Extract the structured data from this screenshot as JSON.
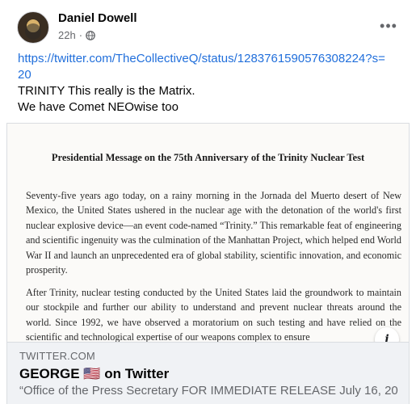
{
  "post": {
    "author": "Daniel Dowell",
    "time": "22h",
    "visibility_icon": "globe-icon",
    "more_icon": "more-options-icon",
    "more_label": "•••",
    "link_url": "https://twitter.com/TheCollectiveQ/status/1283761590576308224?s=20",
    "text_line1": "TRINITY This really is the Matrix.",
    "text_line2": "We have Comet NEOwise too"
  },
  "preview": {
    "doc_title": "Presidential Message on the 75th Anniversary of the Trinity Nuclear Test",
    "doc_para1": "Seventy-five years ago today, on a rainy morning in the Jornada del Muerto desert of New Mexico, the United States ushered in the nuclear age with the detonation of the world's first nuclear explosive device—an event code-named “Trinity.” This remarkable feat of engineering and scientific ingenuity was the culmination of the Manhattan Project, which helped end World War II and launch an unprecedented era of global stability, scientific innovation, and economic prosperity.",
    "doc_para2": "After Trinity, nuclear testing conducted by the United States laid the groundwork to maintain our stockpile and further our ability to understand and prevent nuclear threats around the world. Since 1992, we have observed a moratorium on such testing and have relied on the scientific and technological expertise of our weapons complex to ensure",
    "info_label": "i",
    "domain": "TWITTER.COM",
    "title": "GEORGE 🇺🇸 on Twitter",
    "description": "“Office of the Press Secretary FOR IMMEDIATE RELEASE July 16, 20…"
  }
}
